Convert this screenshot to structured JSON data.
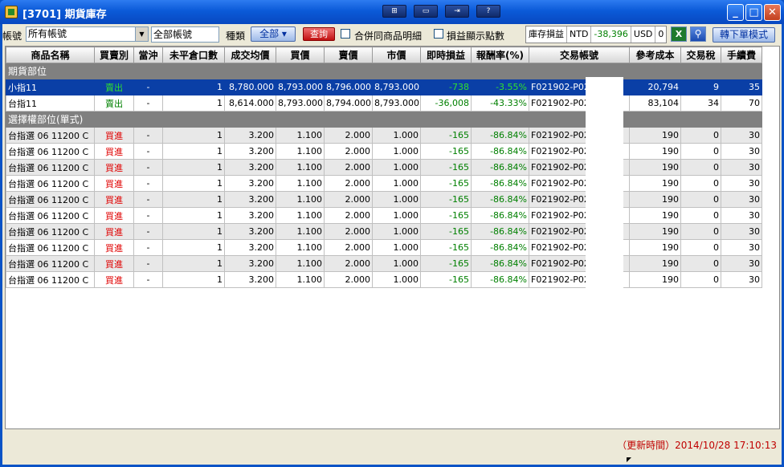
{
  "window": {
    "title": "[3701] 期貨庫存",
    "tools": [
      "⊞",
      "▭",
      "⇥",
      "?"
    ],
    "buttons": [
      "_",
      "□",
      "✕"
    ]
  },
  "toolbar": {
    "account_label": "帳號",
    "account_select": "所有帳號",
    "account_text": "全部帳號",
    "type_label": "種類",
    "type_button": "全部 ▾",
    "query_button": "查詢",
    "merge_label": "合併同商品明細",
    "points_label": "損益顯示點數",
    "pl_label": "庫存損益",
    "pl_ntd_label": "NTD",
    "pl_ntd_value": "-38,396",
    "pl_usd_label": "USD",
    "pl_usd_value": "0",
    "switch_button": "轉下單模式"
  },
  "table": {
    "headers": [
      "商品名稱",
      "買賣別",
      "當沖",
      "未平倉口數",
      "成交均價",
      "買價",
      "賣價",
      "市價",
      "即時損益",
      "報酬率(%)",
      "交易帳號",
      "參考成本",
      "交易稅",
      "手續費"
    ],
    "section_futures": "期貨部位",
    "section_options": "選擇權部位(單式)",
    "futures_rows": [
      [
        "小指11",
        "賣出",
        "-",
        "1",
        "8,780.000",
        "8,793.000",
        "8,796.000",
        "8,793.000",
        "-738",
        "-3.55%",
        "F021902-P02",
        "20,794",
        "9",
        "35"
      ],
      [
        "台指11",
        "賣出",
        "-",
        "1",
        "8,614.000",
        "8,793.000",
        "8,794.000",
        "8,793.000",
        "-36,008",
        "-43.33%",
        "F021902-P02",
        "83,104",
        "34",
        "70"
      ]
    ],
    "option_rows": [
      [
        "台指選 06 11200 C",
        "買進",
        "-",
        "1",
        "3.200",
        "1.100",
        "2.000",
        "1.000",
        "-165",
        "-86.84%",
        "F021902-P02",
        "190",
        "0",
        "30"
      ],
      [
        "台指選 06 11200 C",
        "買進",
        "-",
        "1",
        "3.200",
        "1.100",
        "2.000",
        "1.000",
        "-165",
        "-86.84%",
        "F021902-P02",
        "190",
        "0",
        "30"
      ],
      [
        "台指選 06 11200 C",
        "買進",
        "-",
        "1",
        "3.200",
        "1.100",
        "2.000",
        "1.000",
        "-165",
        "-86.84%",
        "F021902-P02",
        "190",
        "0",
        "30"
      ],
      [
        "台指選 06 11200 C",
        "買進",
        "-",
        "1",
        "3.200",
        "1.100",
        "2.000",
        "1.000",
        "-165",
        "-86.84%",
        "F021902-P02",
        "190",
        "0",
        "30"
      ],
      [
        "台指選 06 11200 C",
        "買進",
        "-",
        "1",
        "3.200",
        "1.100",
        "2.000",
        "1.000",
        "-165",
        "-86.84%",
        "F021902-P02",
        "190",
        "0",
        "30"
      ],
      [
        "台指選 06 11200 C",
        "買進",
        "-",
        "1",
        "3.200",
        "1.100",
        "2.000",
        "1.000",
        "-165",
        "-86.84%",
        "F021902-P02",
        "190",
        "0",
        "30"
      ],
      [
        "台指選 06 11200 C",
        "買進",
        "-",
        "1",
        "3.200",
        "1.100",
        "2.000",
        "1.000",
        "-165",
        "-86.84%",
        "F021902-P02",
        "190",
        "0",
        "30"
      ],
      [
        "台指選 06 11200 C",
        "買進",
        "-",
        "1",
        "3.200",
        "1.100",
        "2.000",
        "1.000",
        "-165",
        "-86.84%",
        "F021902-P02",
        "190",
        "0",
        "30"
      ],
      [
        "台指選 06 11200 C",
        "買進",
        "-",
        "1",
        "3.200",
        "1.100",
        "2.000",
        "1.000",
        "-165",
        "-86.84%",
        "F021902-P02",
        "190",
        "0",
        "30"
      ],
      [
        "台指選 06 11200 C",
        "買進",
        "-",
        "1",
        "3.200",
        "1.100",
        "2.000",
        "1.000",
        "-165",
        "-86.84%",
        "F021902-P02",
        "190",
        "0",
        "30"
      ]
    ]
  },
  "status": {
    "update_text": "（更新時間）2014/10/28 17:10:13"
  },
  "colors": {
    "selected_row": "#0a3fa6",
    "buy": "#e00000",
    "sell": "#008000",
    "section": "#808080"
  }
}
